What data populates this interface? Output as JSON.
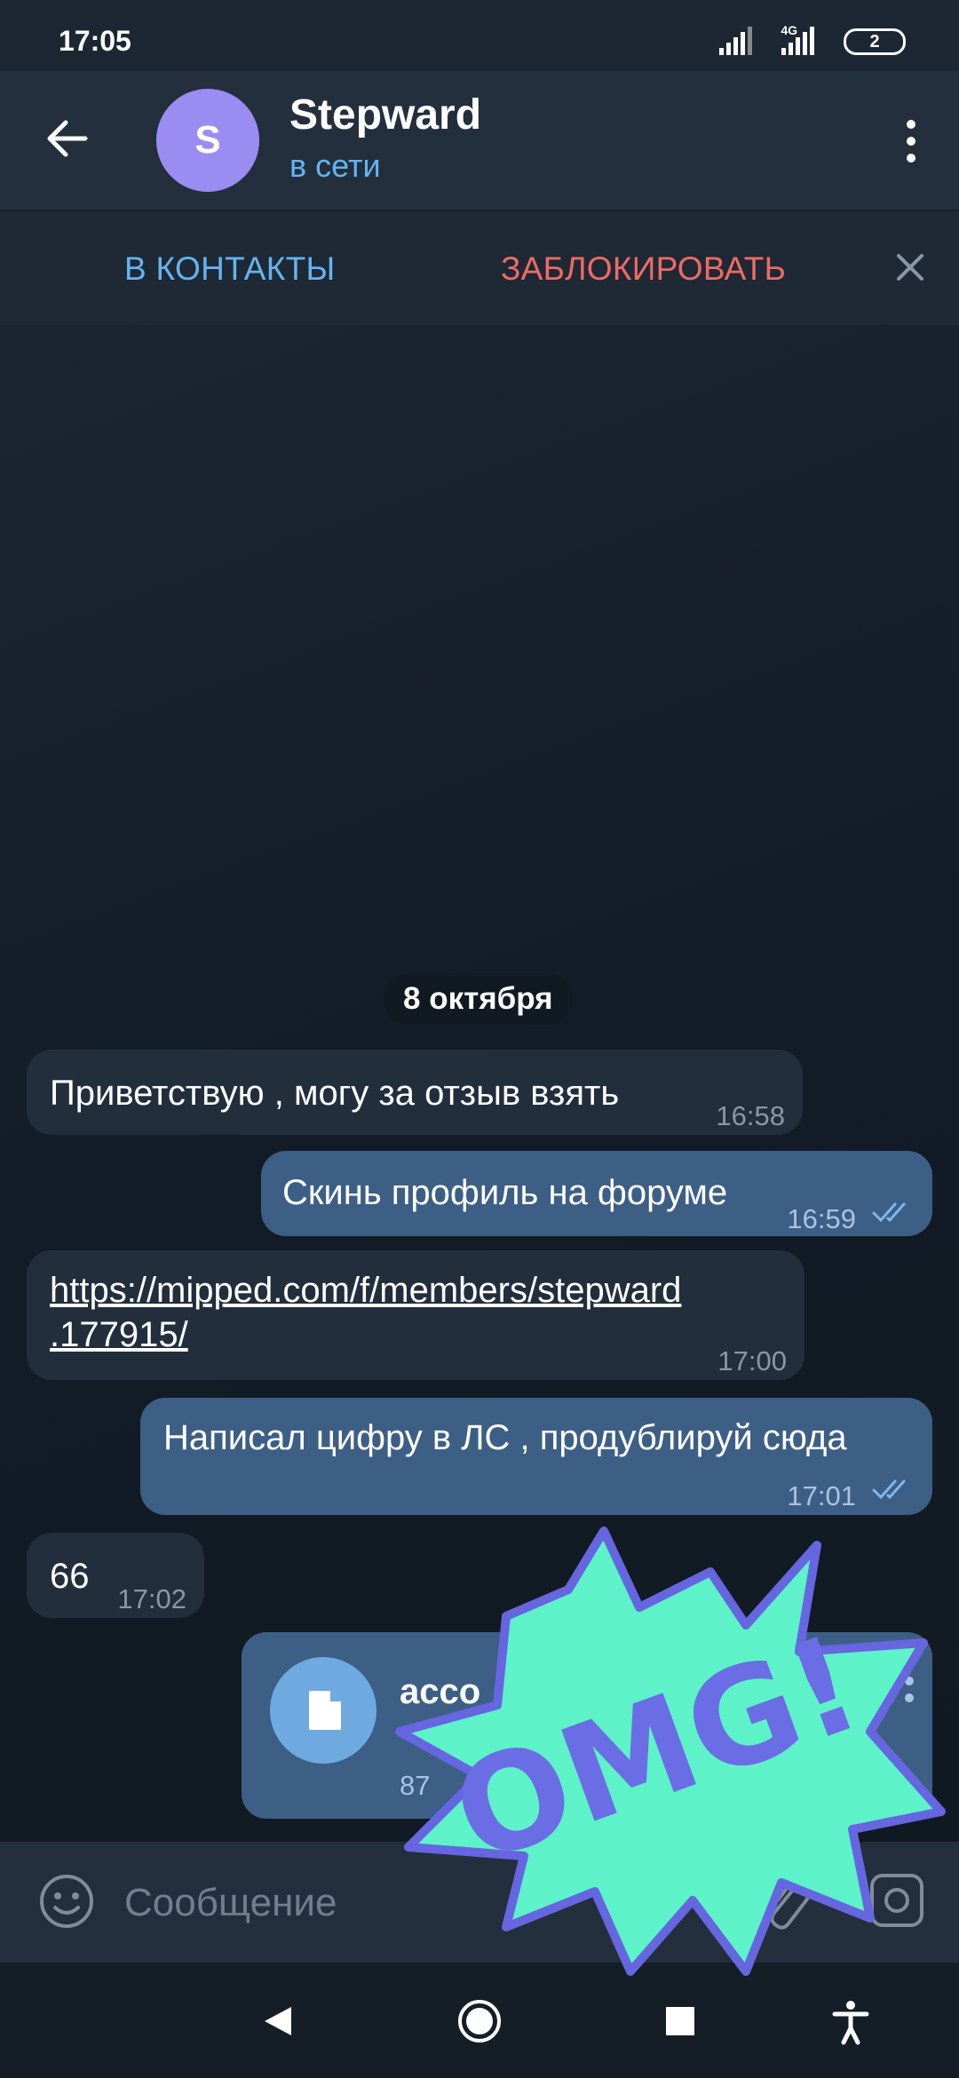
{
  "status_bar": {
    "time": "17:05",
    "network": "4G",
    "battery": "2"
  },
  "header": {
    "avatar_letter": "S",
    "name": "Stepward",
    "status": "в сети"
  },
  "action_bar": {
    "add_contact": "В КОНТАКТЫ",
    "block": "ЗАБЛОКИРОВАТЬ"
  },
  "chat": {
    "date": "8 октября",
    "messages": [
      {
        "direction": "in",
        "text": "Приветствую , могу за отзыв взять",
        "time": "16:58"
      },
      {
        "direction": "out",
        "text": "Скинь профиль на форуме",
        "time": "16:59",
        "read": true
      },
      {
        "direction": "in",
        "link_line1": "https://mipped.com/f/members/stepward",
        "link_line2": ".177915/",
        "time": "17:00"
      },
      {
        "direction": "out",
        "text": "Написал цифру в ЛС , продублируй сюда",
        "time": "17:01",
        "read": true
      },
      {
        "direction": "in",
        "text": "66",
        "time": "17:02"
      },
      {
        "direction": "out",
        "type": "file",
        "file_name": "acco",
        "file_size": "87",
        "read": true
      }
    ]
  },
  "input": {
    "placeholder": "Сообщение"
  },
  "sticker": {
    "text": "OMG!",
    "colors": {
      "fill": "#5df2c8",
      "outline": "#6666e0",
      "text": "#6b6de4"
    }
  },
  "colors": {
    "accent": "#64b4f0",
    "danger": "#ef6b63",
    "incoming_bubble": "#222e3b",
    "outgoing_bubble": "#3d5f85"
  }
}
